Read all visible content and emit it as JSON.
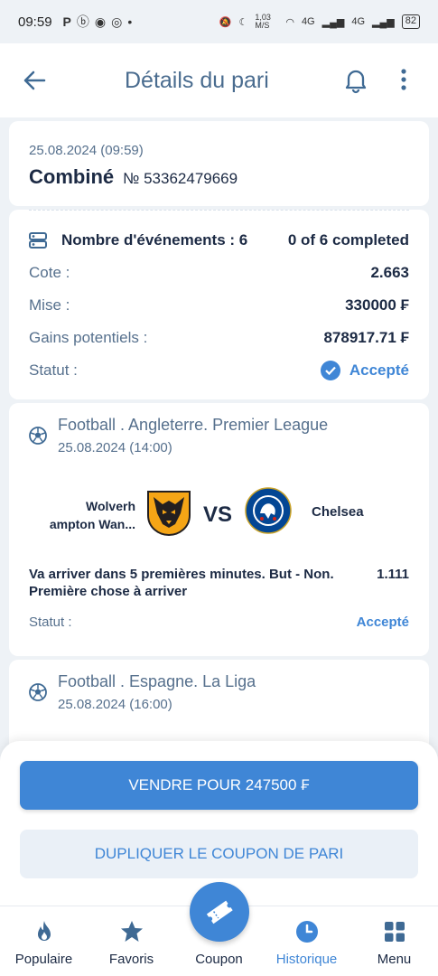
{
  "status_bar": {
    "time": "09:59",
    "notif_icons": [
      "P",
      "ⓑ",
      "◉",
      "◎",
      "•"
    ],
    "net_speed": "1,03 M/S",
    "signal1": "4G",
    "signal2": "4G",
    "battery": "82"
  },
  "header": {
    "title": "Détails du pari"
  },
  "bet": {
    "date": "25.08.2024 (09:59)",
    "type": "Combiné",
    "number": "№ 53362479669",
    "events_label": "Nombre d'événements : 6",
    "completed": "0 of 6 completed",
    "odds_label": "Cote :",
    "odds_value": "2.663",
    "stake_label": "Mise :",
    "stake_value": "330000 ₣",
    "potential_label": "Gains potentiels :",
    "potential_value": "878917.71 ₣",
    "status_label": "Statut :",
    "status_value": "Accepté"
  },
  "events": [
    {
      "league": "Football . Angleterre. Premier League",
      "date": "25.08.2024 (14:00)",
      "team1": "Wolverh\nampton Wan...",
      "team1_line1": "Wolverh",
      "team1_line2": "ampton Wan...",
      "vs": "VS",
      "team2": "Chelsea",
      "pick": "Va arriver dans 5 premières minutes. But - Non. Première chose à arriver",
      "odds": "1.111",
      "status_label": "Statut :",
      "status_value": "Accepté"
    },
    {
      "league": "Football . Espagne. La Liga",
      "date": "25.08.2024 (16:00)"
    }
  ],
  "actions": {
    "sell": "VENDRE POUR 247500 ₣",
    "duplicate": "DUPLIQUER LE COUPON DE PARI"
  },
  "tabs": [
    {
      "label": "Populaire",
      "icon": "flame-icon"
    },
    {
      "label": "Favoris",
      "icon": "star-icon"
    },
    {
      "label": "Coupon",
      "icon": "ticket-icon"
    },
    {
      "label": "Historique",
      "icon": "clock-icon"
    },
    {
      "label": "Menu",
      "icon": "grid-icon"
    }
  ],
  "colors": {
    "accent": "#3f86d6",
    "text_dark": "#1c2a44",
    "text_muted": "#56708d",
    "background": "#eef2f6"
  }
}
